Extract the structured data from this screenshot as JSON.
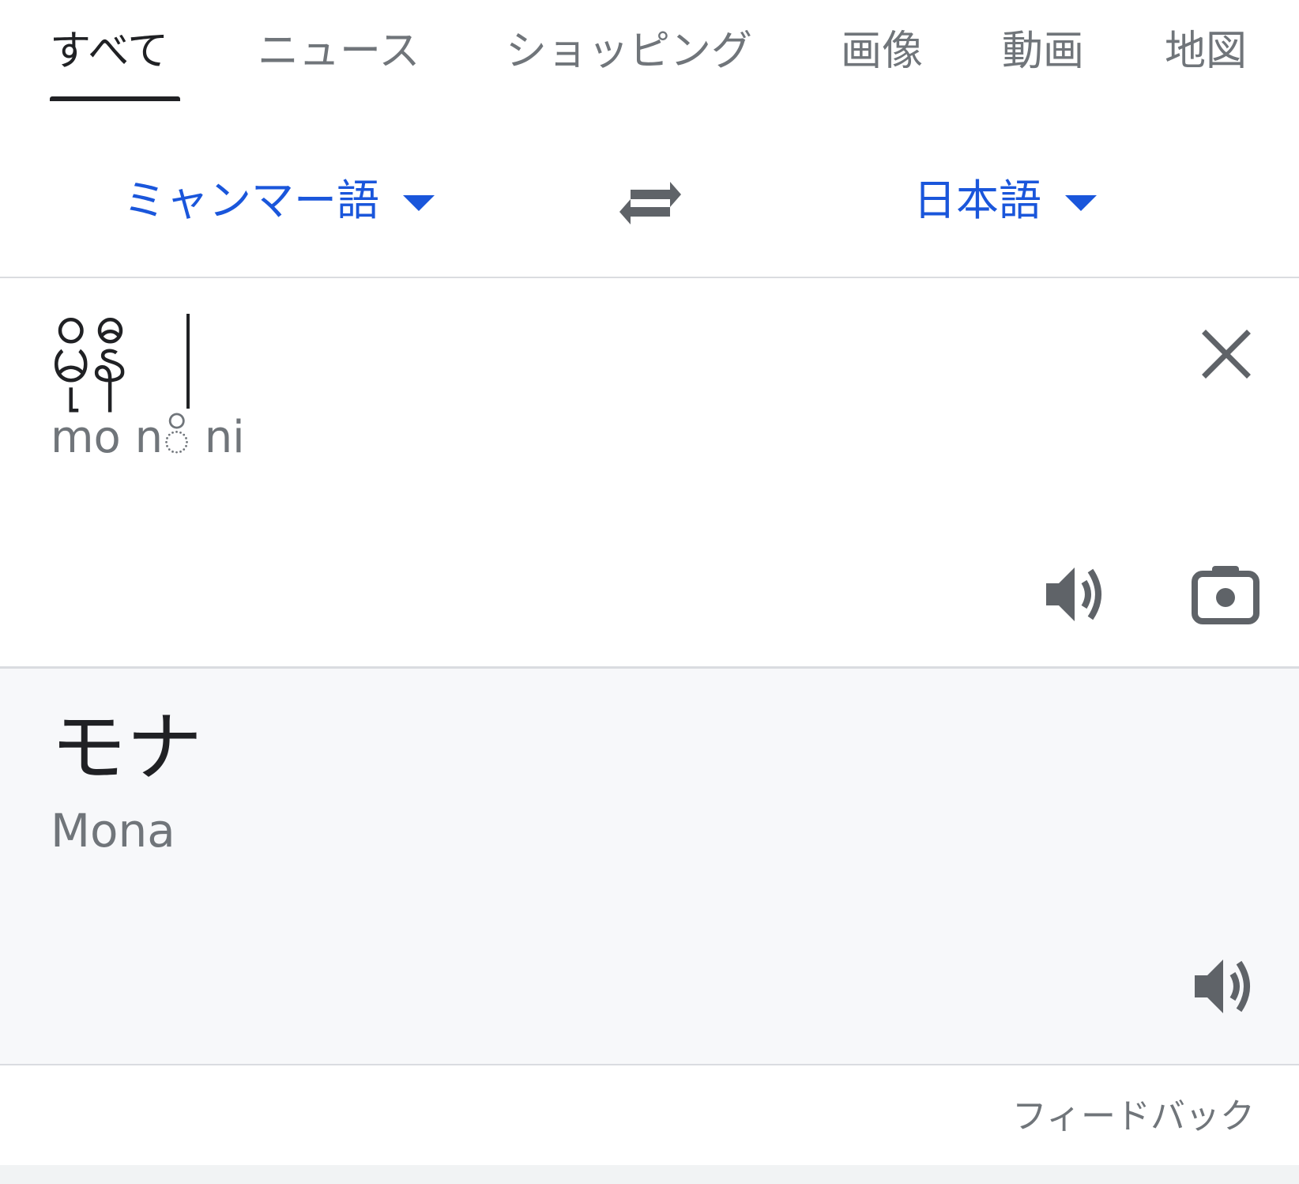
{
  "tabs": [
    {
      "label": "すべて",
      "active": true
    },
    {
      "label": "ニュース",
      "active": false
    },
    {
      "label": "ショッピング",
      "active": false
    },
    {
      "label": "画像",
      "active": false
    },
    {
      "label": "動画",
      "active": false
    },
    {
      "label": "地図",
      "active": false
    }
  ],
  "translator": {
    "source_language": "ミャンマー語",
    "target_language": "日本語",
    "source_text": "မိုနီ",
    "source_transliteration": "mo nိ ni",
    "translation": "モナ",
    "translation_romanized": "Mona"
  },
  "footer": {
    "feedback_label": "フィードバック"
  },
  "colors": {
    "accent": "#1a56db",
    "text_primary": "#202124",
    "text_secondary": "#70757a",
    "result_background": "#f7f8fa",
    "divider": "#dadce0"
  },
  "icons": {
    "swap": "swap-arrows-icon",
    "clear": "close-icon",
    "speaker": "speaker-icon",
    "camera": "camera-icon",
    "caret": "caret-down-icon"
  }
}
